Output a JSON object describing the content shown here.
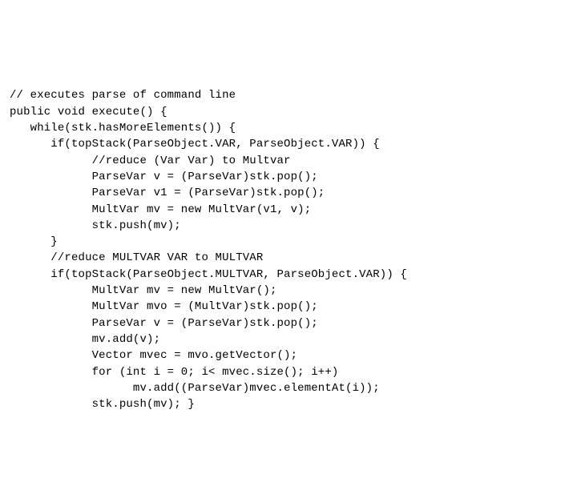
{
  "code_lines": [
    "// executes parse of command line",
    "public void execute() {",
    "   while(stk.hasMoreElements()) {",
    "      if(topStack(ParseObject.VAR, ParseObject.VAR)) {",
    "            //reduce (Var Var) to Multvar",
    "            ParseVar v = (ParseVar)stk.pop();",
    "            ParseVar v1 = (ParseVar)stk.pop();",
    "            MultVar mv = new MultVar(v1, v);",
    "            stk.push(mv);",
    "      }",
    "      //reduce MULTVAR VAR to MULTVAR",
    "      if(topStack(ParseObject.MULTVAR, ParseObject.VAR)) {",
    "            MultVar mv = new MultVar();",
    "            MultVar mvo = (MultVar)stk.pop();",
    "            ParseVar v = (ParseVar)stk.pop();",
    "            mv.add(v);",
    "            Vector mvec = mvo.getVector();",
    "            for (int i = 0; i< mvec.size(); i++)",
    "                  mv.add((ParseVar)mvec.elementAt(i));",
    "            stk.push(mv); }"
  ]
}
